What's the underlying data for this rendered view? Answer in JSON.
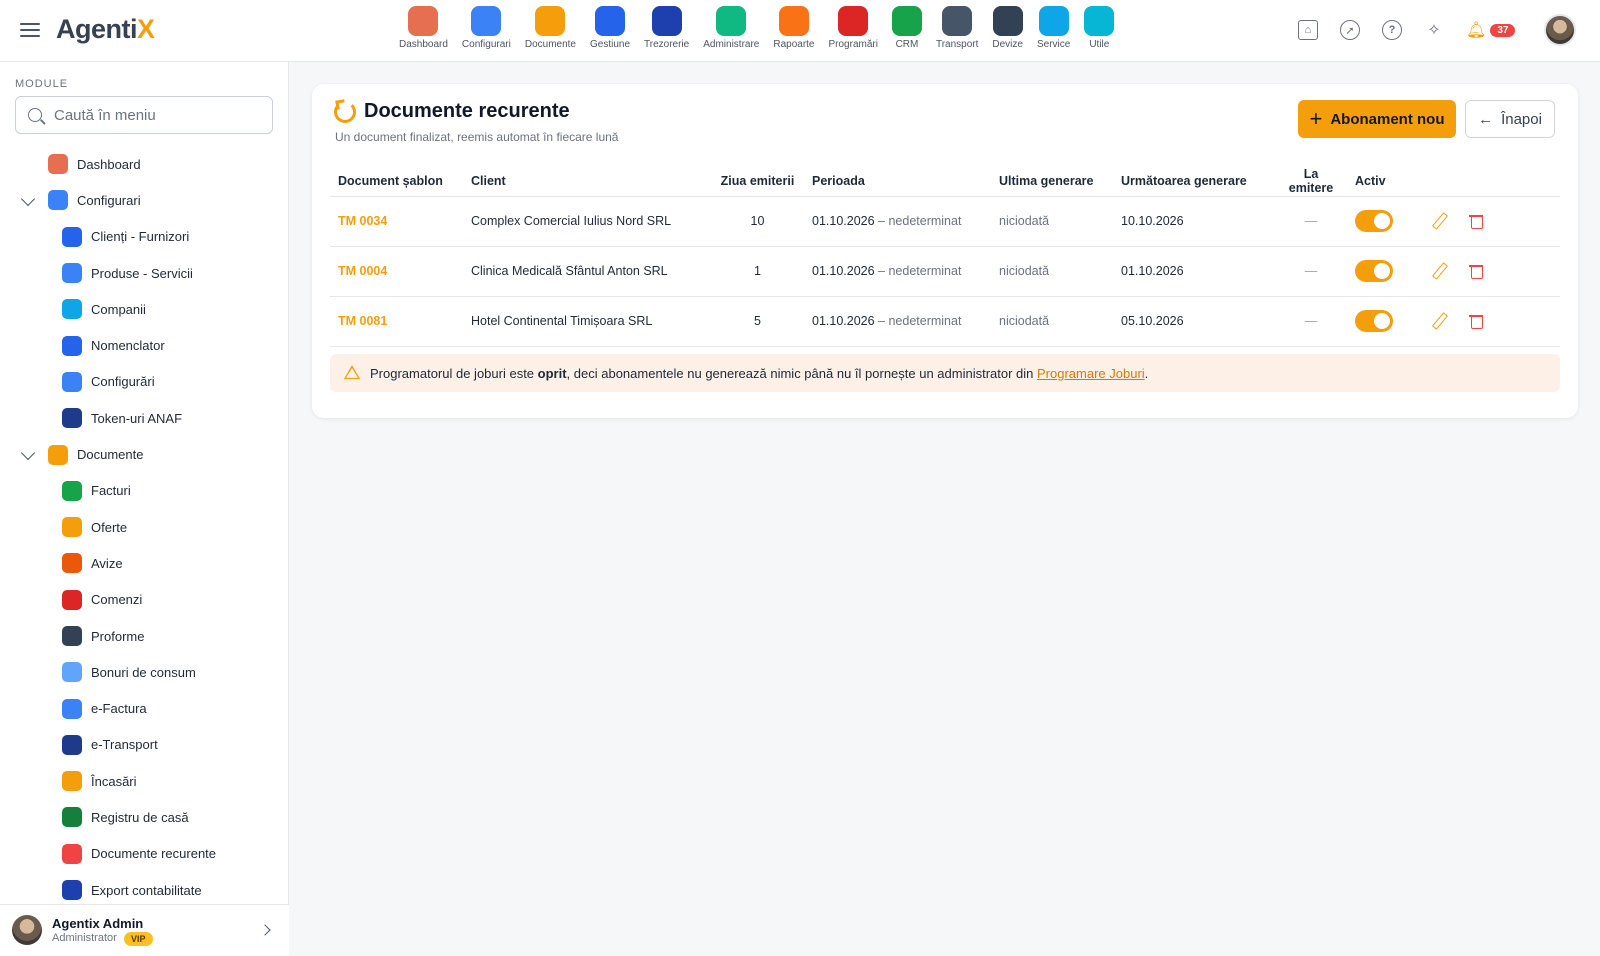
{
  "app": {
    "logo_main": "Agenti",
    "logo_accent": "X"
  },
  "modules": [
    {
      "label": "Dashboard",
      "icon": "dashboard-icon",
      "color": "#e76f51"
    },
    {
      "label": "Configurari",
      "icon": "wrench-icon",
      "color": "#3b82f6"
    },
    {
      "label": "Documente",
      "icon": "documents-icon",
      "color": "#f59e0b"
    },
    {
      "label": "Gestiune",
      "icon": "warehouse-icon",
      "color": "#2563eb"
    },
    {
      "label": "Trezorerie",
      "icon": "bank-icon",
      "color": "#1e40af"
    },
    {
      "label": "Administrare",
      "icon": "shield-icon",
      "color": "#10b981"
    },
    {
      "label": "Rapoarte",
      "icon": "pie-chart-icon",
      "color": "#f97316"
    },
    {
      "label": "Programări",
      "icon": "clock-icon",
      "color": "#dc2626"
    },
    {
      "label": "CRM",
      "icon": "crm-icon",
      "color": "#16a34a"
    },
    {
      "label": "Transport",
      "icon": "truck-icon",
      "color": "#475569"
    },
    {
      "label": "Devize",
      "icon": "checklist-icon",
      "color": "#334155"
    },
    {
      "label": "Service",
      "icon": "car-icon",
      "color": "#0ea5e9"
    },
    {
      "label": "Utile",
      "icon": "help-icon",
      "color": "#06b6d4"
    }
  ],
  "topbar": {
    "notifications_count": "37"
  },
  "sidebar": {
    "heading": "MODULE",
    "search_placeholder": "Caută în meniu",
    "items": [
      {
        "label": "Dashboard",
        "level": "top",
        "icon": "dashboard-icon",
        "color": "#e76f51"
      },
      {
        "label": "Configurari",
        "level": "top",
        "expanded": true,
        "icon": "wrench-icon",
        "color": "#3b82f6"
      },
      {
        "label": "Clienți - Furnizori",
        "level": "sub",
        "icon": "people-icon",
        "color": "#2563eb"
      },
      {
        "label": "Produse - Servicii",
        "level": "sub",
        "icon": "list-icon",
        "color": "#3b82f6"
      },
      {
        "label": "Companii",
        "level": "sub",
        "icon": "building-icon",
        "color": "#0ea5e9"
      },
      {
        "label": "Nomenclator",
        "level": "sub",
        "icon": "bullets-icon",
        "color": "#2563eb"
      },
      {
        "label": "Configurări",
        "level": "sub",
        "icon": "settings-list-icon",
        "color": "#3b82f6"
      },
      {
        "label": "Token-uri ANAF",
        "level": "sub",
        "icon": "lock-shield-icon",
        "color": "#1e3a8a"
      },
      {
        "label": "Documente",
        "level": "top",
        "expanded": true,
        "icon": "documents-icon",
        "color": "#f59e0b"
      },
      {
        "label": "Facturi",
        "level": "sub",
        "icon": "invoice-icon",
        "color": "#16a34a"
      },
      {
        "label": "Oferte",
        "level": "sub",
        "icon": "offer-icon",
        "color": "#f59e0b"
      },
      {
        "label": "Avize",
        "level": "sub",
        "icon": "delivery-truck-icon",
        "color": "#ea580c"
      },
      {
        "label": "Comenzi",
        "level": "sub",
        "icon": "cart-icon",
        "color": "#dc2626"
      },
      {
        "label": "Proforme",
        "level": "sub",
        "icon": "proforma-icon",
        "color": "#334155"
      },
      {
        "label": "Bonuri de consum",
        "level": "sub",
        "icon": "receipt-icon",
        "color": "#60a5fa"
      },
      {
        "label": "e-Factura",
        "level": "sub",
        "icon": "cloud-icon",
        "color": "#3b82f6"
      },
      {
        "label": "e-Transport",
        "level": "sub",
        "icon": "transport-icon",
        "color": "#1e3a8a"
      },
      {
        "label": "Încasări",
        "level": "sub",
        "icon": "growth-icon",
        "color": "#f59e0b"
      },
      {
        "label": "Registru de casă",
        "level": "sub",
        "icon": "cash-register-icon",
        "color": "#15803d"
      },
      {
        "label": "Documente recurente",
        "level": "sub",
        "icon": "recurring-icon",
        "color": "#ef4444"
      },
      {
        "label": "Export contabilitate",
        "level": "sub",
        "icon": "export-db-icon",
        "color": "#1e40af"
      }
    ],
    "user": {
      "name": "Agentix Admin",
      "role": "Administrator",
      "badge": "VIP"
    }
  },
  "page": {
    "title": "Documente recurente",
    "subtitle": "Un document finalizat, reemis automat în fiecare lună",
    "new_button": "Abonament nou",
    "back_button": "Înapoi"
  },
  "table": {
    "headers": [
      "Document șablon",
      "Client",
      "Ziua emiterii",
      "Perioada",
      "Ultima generare",
      "Următoarea generare",
      "La emitere",
      "Activ"
    ],
    "rows": [
      {
        "template": "TM 0034",
        "client": "Complex Comercial Iulius Nord SRL",
        "day": "10",
        "period_start": "01.10.2026",
        "period_end": "– nedeterminat",
        "last": "niciodată",
        "next": "10.10.2026",
        "on_issue": "—",
        "active": true
      },
      {
        "template": "TM 0004",
        "client": "Clinica Medicală Sfântul Anton SRL",
        "day": "1",
        "period_start": "01.10.2026",
        "period_end": "– nedeterminat",
        "last": "niciodată",
        "next": "01.10.2026",
        "on_issue": "—",
        "active": true
      },
      {
        "template": "TM 0081",
        "client": "Hotel Continental Timișoara SRL",
        "day": "5",
        "period_start": "01.10.2026",
        "period_end": "– nedeterminat",
        "last": "niciodată",
        "next": "05.10.2026",
        "on_issue": "—",
        "active": true
      }
    ]
  },
  "alert": {
    "text_before": "Programatorul de joburi este ",
    "bold": "oprit",
    "text_after": ", deci abonamentele nu generează nimic până nu îl pornește un administrator din ",
    "link": "Programare Joburi",
    "end": "."
  }
}
